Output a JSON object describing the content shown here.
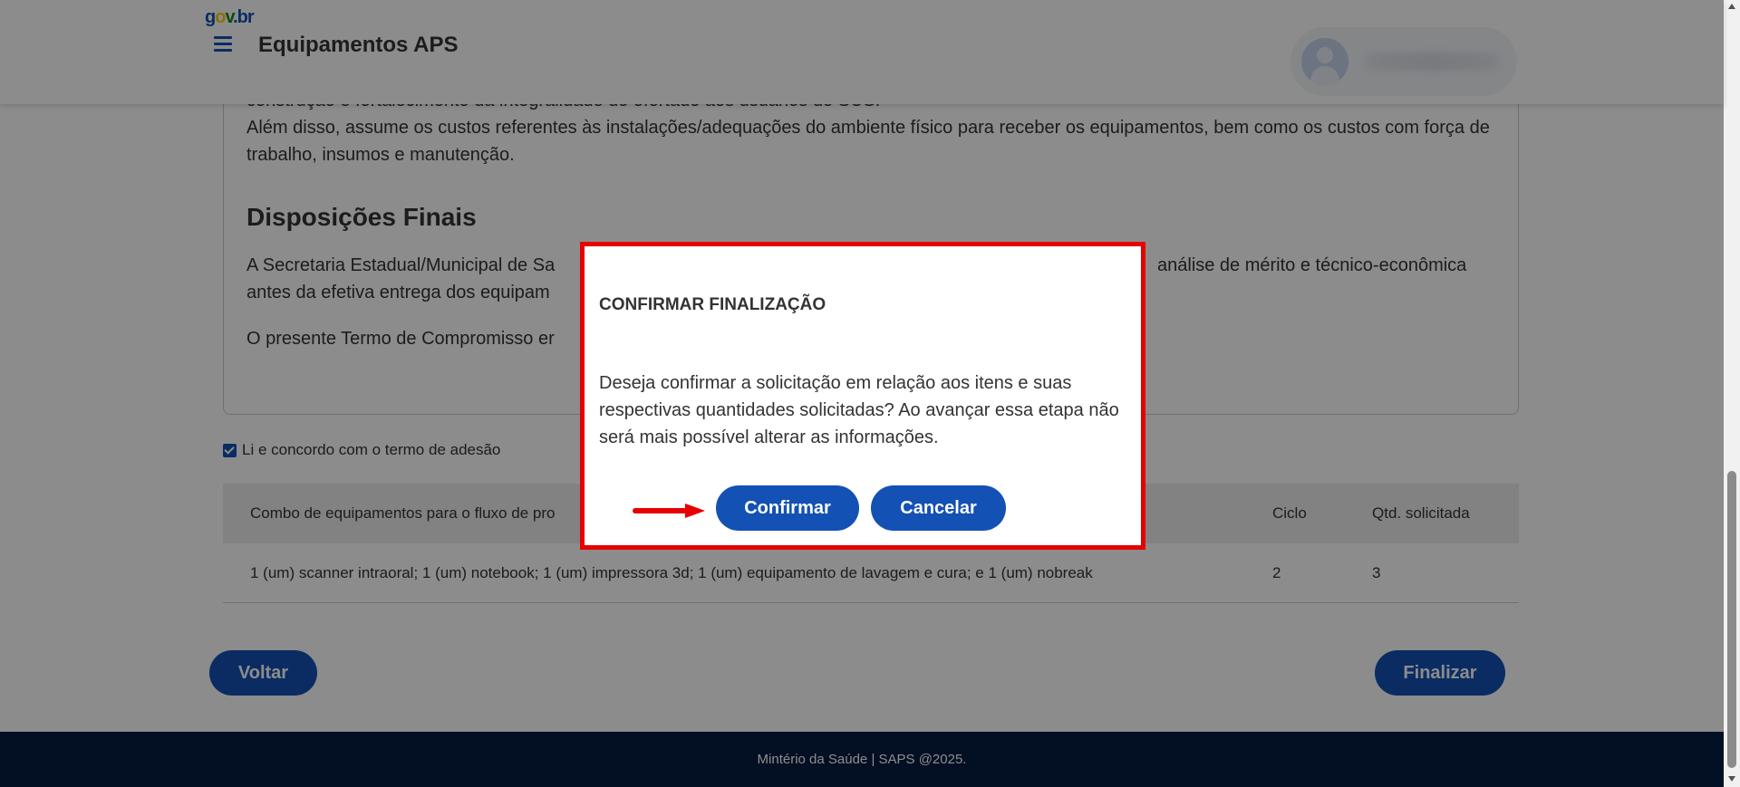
{
  "header": {
    "logo": {
      "g": "g",
      "o": "o",
      "v": "v",
      "dot": ".",
      "br": "br"
    },
    "title": "Equipamentos APS",
    "menu_icon": "hamburger-menu-icon",
    "user_icon": "user-avatar-icon"
  },
  "terms": {
    "partial_line": "construção e fortalecimento da integralidade do ofertado aos usuários do SUS.",
    "paragraph_1": "Além disso, assume os custos referentes às instalações/adequações do ambiente físico para receber os equipamentos, bem como os custos com força de trabalho, insumos e manutenção.",
    "heading": "Disposições Finais",
    "paragraph_2_start": "A Secretaria Estadual/Municipal de Sa",
    "paragraph_2_end": "análise de mérito e técnico-econômica",
    "paragraph_2_line2": "antes da efetiva entrega dos equipam",
    "paragraph_3": "O presente Termo de Compromisso er"
  },
  "agreement": {
    "label": "Li e concordo com o termo de adesão",
    "checked": true
  },
  "table": {
    "headers": [
      "Combo de equipamentos para o fluxo de pro",
      "Ciclo",
      "Qtd. solicitada"
    ],
    "rows": [
      [
        "1 (um) scanner intraoral; 1 (um) notebook; 1 (um) impressora 3d; 1 (um) equipamento de lavagem e cura; e 1 (um) nobreak",
        "2",
        "3"
      ]
    ]
  },
  "buttons": {
    "back": "Voltar",
    "finish": "Finalizar"
  },
  "footer": {
    "text": "Mintério da Saúde | SAPS @2025."
  },
  "modal": {
    "title": "CONFIRMAR FINALIZAÇÃO",
    "body": "Deseja confirmar a solicitação em relação aos itens e suas respectivas quantidades solicitadas? Ao avançar essa etapa não será mais possível alterar as informações.",
    "confirm": "Confirmar",
    "cancel": "Cancelar",
    "highlight_color": "#e60000",
    "arrow_color": "#e60000"
  },
  "colors": {
    "primary": "#1351b4",
    "footer_bg": "#071d41",
    "overlay": "rgba(0,0,0,0.45)"
  }
}
